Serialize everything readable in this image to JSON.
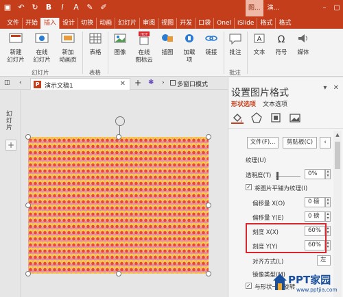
{
  "colors": {
    "accent": "#c43e1c",
    "highlight": "#d9262c"
  },
  "title_bar": {
    "context_tab": "图...",
    "doc_title": "演...",
    "qat_icons": [
      "save-icon",
      "undo-icon",
      "redo-icon",
      "bold-icon",
      "italic-icon"
    ]
  },
  "tabs": [
    "文件",
    "开始",
    "插入",
    "设计",
    "切换",
    "动画",
    "幻灯片",
    "审阅",
    "视图",
    "开发",
    "口袋",
    "Onel",
    "iSlide",
    "格式",
    "格式"
  ],
  "active_tab_index": 2,
  "ribbon": {
    "new_slide": "新建\n幻灯片",
    "online_slide": "在线\n幻灯片",
    "new_album": "新加\n动画页",
    "table": "表格",
    "image": "图像",
    "online_icons": "在线\n图标云",
    "illustrations": "插图",
    "addins": "加载\n项",
    "link": "链接",
    "comment": "批注",
    "text": "文本",
    "symbol": "符号",
    "media": "媒体",
    "group_slides": "幻灯片",
    "group_table": "表格",
    "group_comment": "批注",
    "hot_badge": "HOT"
  },
  "doc_tabs": {
    "doc_name": "演示文稿1",
    "multi_window": "多窗口模式"
  },
  "left_strip": {
    "label": "幻灯片"
  },
  "pane": {
    "title": "设置图片格式",
    "tab_shape": "形状选项",
    "tab_text": "文本选项",
    "file_btn": "文件(F)...",
    "clipboard_btn": "剪贴板(C)",
    "texture_label": "纹理(U)",
    "transparency_label": "透明度(T)",
    "transparency_value": "0%",
    "tile_label": "将图片平铺为纹理(I)",
    "offset_x_label": "偏移量 X(O)",
    "offset_x_value": "0 磅",
    "offset_y_label": "偏移量 Y(E)",
    "offset_y_value": "0 磅",
    "scale_x_label": "刻度 X(X)",
    "scale_x_value": "60%",
    "scale_y_label": "刻度 Y(Y)",
    "scale_y_value": "60%",
    "align_label": "对齐方式(L)",
    "align_value": "左",
    "mirror_label": "镜像类型(M)",
    "rotate_label": "与形状一起旋转"
  },
  "watermark": {
    "text": "PPT家园",
    "url": "www.pptjia.com"
  }
}
